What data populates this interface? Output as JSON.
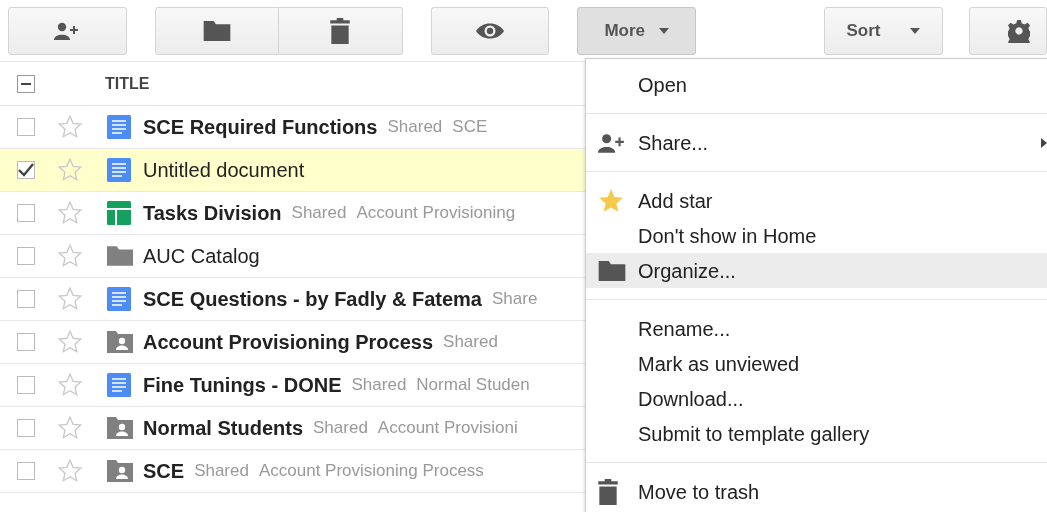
{
  "toolbar": {
    "more_label": "More",
    "more_pressed": true,
    "sort_label": "Sort"
  },
  "list": {
    "header": {
      "title": "TITLE",
      "select_all_partial": true
    },
    "rows": [
      {
        "kind": "doc",
        "name": "SCE Required Functions",
        "unread": true,
        "checked": false,
        "selected": false,
        "starred": false,
        "tags": [
          "Shared",
          "SCE"
        ]
      },
      {
        "kind": "doc",
        "name": "Untitled document",
        "unread": false,
        "checked": true,
        "selected": true,
        "starred": false,
        "tags": []
      },
      {
        "kind": "sheet",
        "name": "Tasks Division",
        "unread": true,
        "checked": false,
        "selected": false,
        "starred": false,
        "tags": [
          "Shared",
          "Account Provisioning"
        ]
      },
      {
        "kind": "folder",
        "name": "AUC Catalog",
        "unread": false,
        "checked": false,
        "selected": false,
        "starred": false,
        "tags": []
      },
      {
        "kind": "doc",
        "name": "SCE Questions - by Fadly & Fatema",
        "unread": true,
        "checked": false,
        "selected": false,
        "starred": false,
        "tags": [
          "Share"
        ]
      },
      {
        "kind": "shared-folder",
        "name": "Account Provisioning Process",
        "unread": true,
        "checked": false,
        "selected": false,
        "starred": false,
        "tags": [
          "Shared"
        ]
      },
      {
        "kind": "doc",
        "name": "Fine Tunings - DONE",
        "unread": true,
        "checked": false,
        "selected": false,
        "starred": false,
        "tags": [
          "Shared",
          "Normal Studen"
        ]
      },
      {
        "kind": "shared-folder",
        "name": "Normal Students",
        "unread": true,
        "checked": false,
        "selected": false,
        "starred": false,
        "tags": [
          "Shared",
          "Account Provisioni"
        ]
      },
      {
        "kind": "shared-folder",
        "name": "SCE",
        "unread": true,
        "checked": false,
        "selected": false,
        "starred": false,
        "tags": [
          "Shared",
          "Account Provisioning Process"
        ]
      }
    ]
  },
  "menu": {
    "groups": [
      [
        {
          "label": "Open",
          "kind": "plain",
          "selected": false
        }
      ],
      [
        {
          "label": "Share...",
          "kind": "share",
          "selected": false,
          "submenu": true
        }
      ],
      [
        {
          "label": "Add star",
          "kind": "star",
          "selected": false
        },
        {
          "label": "Don't show in Home",
          "kind": "plain",
          "selected": false
        },
        {
          "label": "Organize...",
          "kind": "folder",
          "selected": true
        }
      ],
      [
        {
          "label": "Rename...",
          "kind": "plain",
          "selected": false
        },
        {
          "label": "Mark as unviewed",
          "kind": "plain",
          "selected": false
        },
        {
          "label": "Download...",
          "kind": "plain",
          "selected": false
        },
        {
          "label": "Submit to template gallery",
          "kind": "plain",
          "selected": false
        }
      ],
      [
        {
          "label": "Move to trash",
          "kind": "trash",
          "selected": false
        }
      ]
    ]
  }
}
